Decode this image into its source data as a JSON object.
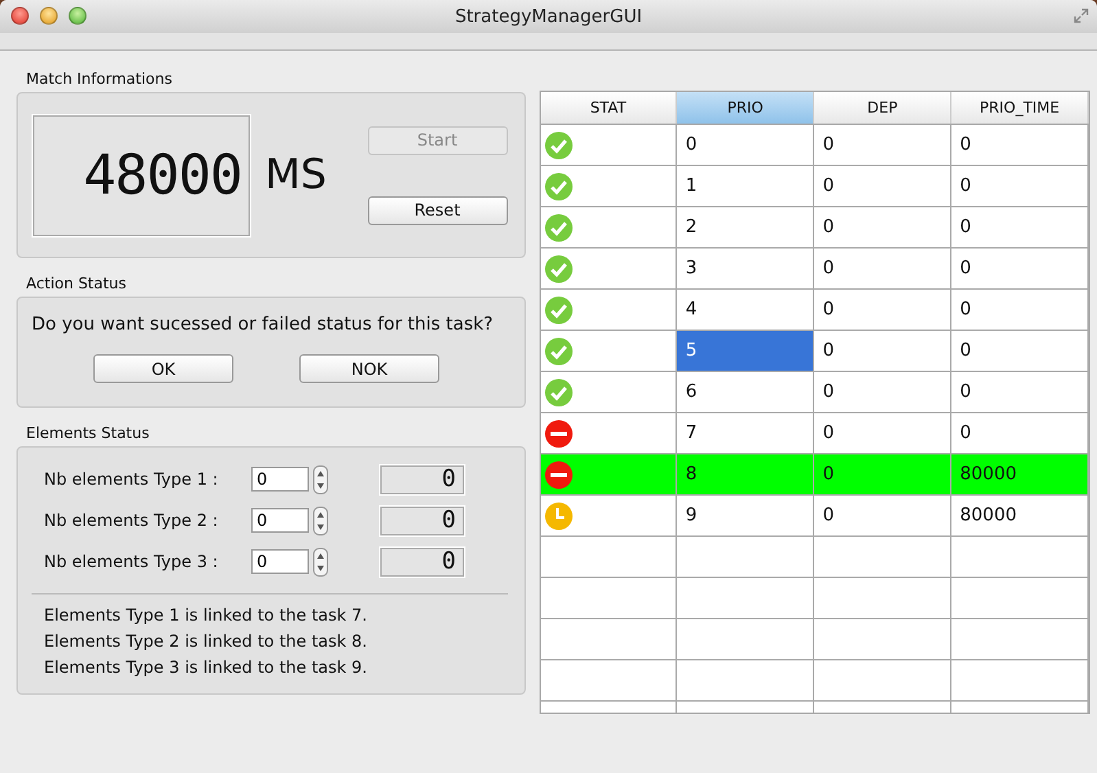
{
  "window": {
    "title": "StrategyManagerGUI"
  },
  "match": {
    "title": "Match Informations",
    "timer": "48000",
    "unit": "MS",
    "buttons": [
      {
        "label": "Start",
        "disabled": true
      },
      {
        "label": "Reset",
        "disabled": false
      }
    ]
  },
  "action": {
    "title": "Action Status",
    "question": "Do you want sucessed or failed status for this task?",
    "buttons": [
      {
        "label": "OK"
      },
      {
        "label": "NOK"
      }
    ]
  },
  "elements": {
    "title": "Elements Status",
    "rows": [
      {
        "label": "Nb elements Type 1 :",
        "value": "0",
        "display": "0"
      },
      {
        "label": "Nb elements Type 2 :",
        "value": "0",
        "display": "0"
      },
      {
        "label": "Nb elements Type 3 :",
        "value": "0",
        "display": "0"
      }
    ],
    "notes": [
      "Elements Type 1 is linked to the task 7.",
      "Elements Type 2 is linked to the task 8.",
      "Elements Type 3 is linked to the task 9."
    ]
  },
  "table": {
    "columns": [
      {
        "label": "STAT",
        "selected": false
      },
      {
        "label": "PRIO",
        "selected": true
      },
      {
        "label": "DEP",
        "selected": false
      },
      {
        "label": "PRIO_TIME",
        "selected": false
      }
    ],
    "rows": [
      {
        "kind": "done",
        "prio": "0",
        "dep": "0",
        "prio_time": "0",
        "selected": false,
        "highlighted": false
      },
      {
        "kind": "done",
        "prio": "1",
        "dep": "0",
        "prio_time": "0",
        "selected": false,
        "highlighted": false
      },
      {
        "kind": "done",
        "prio": "2",
        "dep": "0",
        "prio_time": "0",
        "selected": false,
        "highlighted": false
      },
      {
        "kind": "done",
        "prio": "3",
        "dep": "0",
        "prio_time": "0",
        "selected": false,
        "highlighted": false
      },
      {
        "kind": "done",
        "prio": "4",
        "dep": "0",
        "prio_time": "0",
        "selected": false,
        "highlighted": false
      },
      {
        "kind": "done",
        "prio": "5",
        "dep": "0",
        "prio_time": "0",
        "selected": true,
        "highlighted": false
      },
      {
        "kind": "done",
        "prio": "6",
        "dep": "0",
        "prio_time": "0",
        "selected": false,
        "highlighted": false
      },
      {
        "kind": "failed",
        "prio": "7",
        "dep": "0",
        "prio_time": "0",
        "selected": false,
        "highlighted": false
      },
      {
        "kind": "failed",
        "prio": "8",
        "dep": "0",
        "prio_time": "80000",
        "selected": false,
        "highlighted": true
      },
      {
        "kind": "waiting",
        "prio": "9",
        "dep": "0",
        "prio_time": "80000",
        "selected": false,
        "highlighted": false
      }
    ]
  }
}
